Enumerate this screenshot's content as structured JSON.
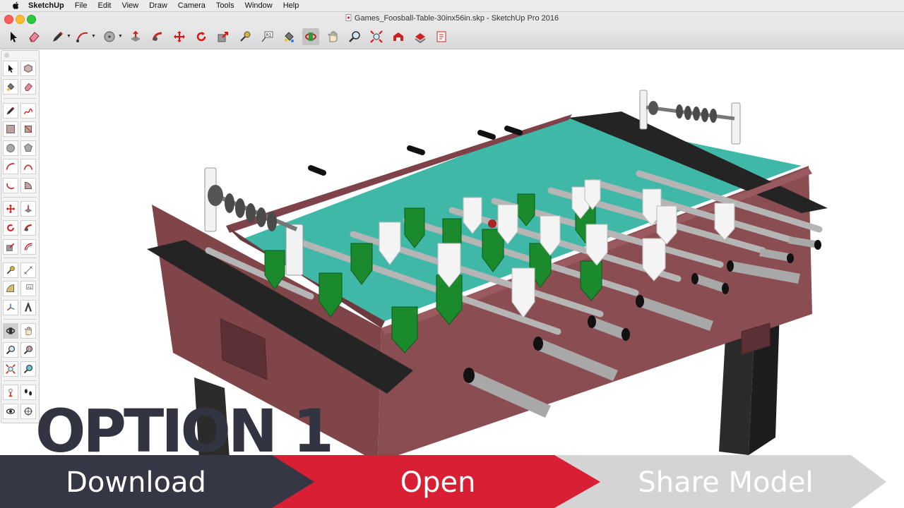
{
  "menubar": {
    "app_name": "SketchUp",
    "items": [
      "File",
      "Edit",
      "View",
      "Draw",
      "Camera",
      "Tools",
      "Window",
      "Help"
    ]
  },
  "window": {
    "title": "Games_Foosball-Table-30inx56in.skp - SketchUp Pro 2016",
    "traffic_lights": {
      "close": "#fc5f57",
      "minimize": "#fdbc2e",
      "zoom": "#28c840"
    }
  },
  "toolbar": {
    "tools": [
      "select-icon",
      "eraser-icon",
      "pencil-icon",
      "arc-icon",
      "circle-icon",
      "push-pull-icon",
      "follow-me-icon",
      "move-icon",
      "rotate-icon",
      "scale-icon",
      "tape-measure-icon",
      "text-icon",
      "paint-bucket-icon",
      "orbit-icon",
      "pan-icon",
      "zoom-icon",
      "zoom-extents-icon",
      "3d-warehouse-icon",
      "extension-warehouse-icon",
      "layout-icon"
    ]
  },
  "palette": {
    "tools": [
      "select-icon",
      "make-component-icon",
      "paint-bucket-icon",
      "eraser-icon",
      "pencil-icon",
      "freehand-icon",
      "rectangle-icon",
      "rotated-rectangle-icon",
      "circle-icon",
      "polygon-icon",
      "arc-icon",
      "two-point-arc-icon",
      "three-point-arc-icon",
      "pie-icon",
      "move-icon",
      "push-pull-icon",
      "rotate-icon",
      "follow-me-icon",
      "scale-icon",
      "offset-icon",
      "tape-measure-icon",
      "dimension-icon",
      "protractor-icon",
      "text-icon",
      "axes-icon",
      "3d-text-icon",
      "orbit-icon",
      "pan-icon",
      "zoom-icon",
      "zoom-window-icon",
      "zoom-extents-icon",
      "previous-view-icon",
      "position-camera-icon",
      "walk-icon",
      "look-around-icon",
      "section-plane-icon"
    ]
  },
  "overlay": {
    "option_title": "OPTION 1",
    "steps": [
      {
        "label": "Download",
        "color": "#363744",
        "text_color": "#ffffff"
      },
      {
        "label": "Open",
        "color": "#d81f33",
        "text_color": "#ffffff"
      },
      {
        "label": "Share Model",
        "color": "#d4d4d4",
        "text_color": "#ffffff"
      }
    ]
  },
  "colors": {
    "table_body": "#8a4d52",
    "table_body_dark": "#6b3a3f",
    "playfield": "#3fb8a8",
    "team_a": "#1a8a2c",
    "team_b": "#f4f4f4",
    "rods": "#b5b5b5",
    "legs": "#2b2b2b"
  }
}
